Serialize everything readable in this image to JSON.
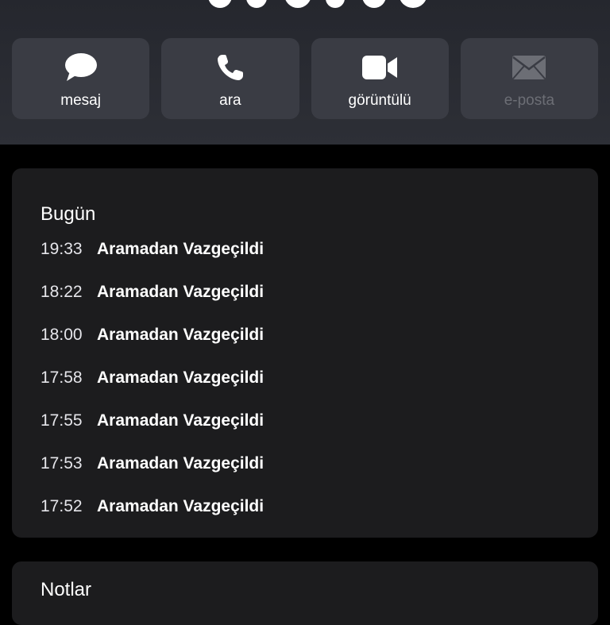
{
  "actions": [
    {
      "label": "mesaj",
      "icon": "message-bubble-icon",
      "enabled": true
    },
    {
      "label": "ara",
      "icon": "phone-icon",
      "enabled": true
    },
    {
      "label": "görüntülü",
      "icon": "video-camera-icon",
      "enabled": true
    },
    {
      "label": "e-posta",
      "icon": "envelope-icon",
      "enabled": false
    }
  ],
  "recents": {
    "title": "Bugün",
    "calls": [
      {
        "time": "19:33",
        "status": "Aramadan Vazgeçildi"
      },
      {
        "time": "18:22",
        "status": "Aramadan Vazgeçildi"
      },
      {
        "time": "18:00",
        "status": "Aramadan Vazgeçildi"
      },
      {
        "time": "17:58",
        "status": "Aramadan Vazgeçildi"
      },
      {
        "time": "17:55",
        "status": "Aramadan Vazgeçildi"
      },
      {
        "time": "17:53",
        "status": "Aramadan Vazgeçildi"
      },
      {
        "time": "17:52",
        "status": "Aramadan Vazgeçildi"
      }
    ]
  },
  "notes": {
    "title": "Notlar"
  },
  "colors": {
    "background": "#000000",
    "header": "#2d2f36",
    "button": "#3a3c44",
    "card": "#1c1c1e",
    "disabled_text": "#6c6e75"
  }
}
